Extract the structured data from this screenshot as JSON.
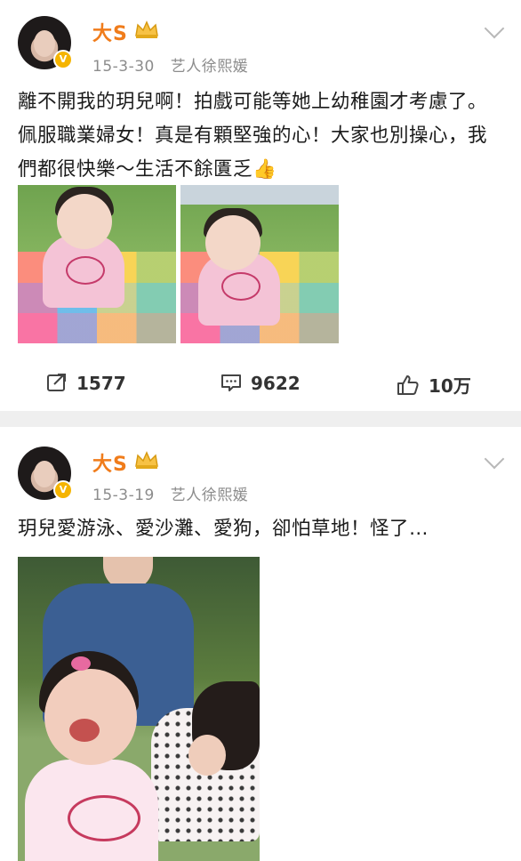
{
  "colors": {
    "name": "#f07c1b",
    "meta": "#8c8c8c",
    "vip": "#f5b400"
  },
  "posts": [
    {
      "author": "大S",
      "date": "15-3-30",
      "source": "艺人徐熙媛",
      "text": "離不開我的玥兒啊！拍戲可能等她上幼稚園才考慮了。佩服職業婦女！真是有顆堅強的心！大家也別操心，我們都很快樂～生活不餘匱乏👍",
      "reposts": "1577",
      "comments": "9622",
      "likes": "10万",
      "icons": [
        "avatar",
        "crown-badge-icon",
        "verified-icon",
        "chevron-down-icon",
        "repost-icon",
        "comment-icon",
        "like-icon"
      ]
    },
    {
      "author": "大S",
      "date": "15-3-19",
      "source": "艺人徐熙媛",
      "text": "玥兒愛游泳、愛沙灘、愛狗，卻怕草地！怪了…"
    }
  ]
}
